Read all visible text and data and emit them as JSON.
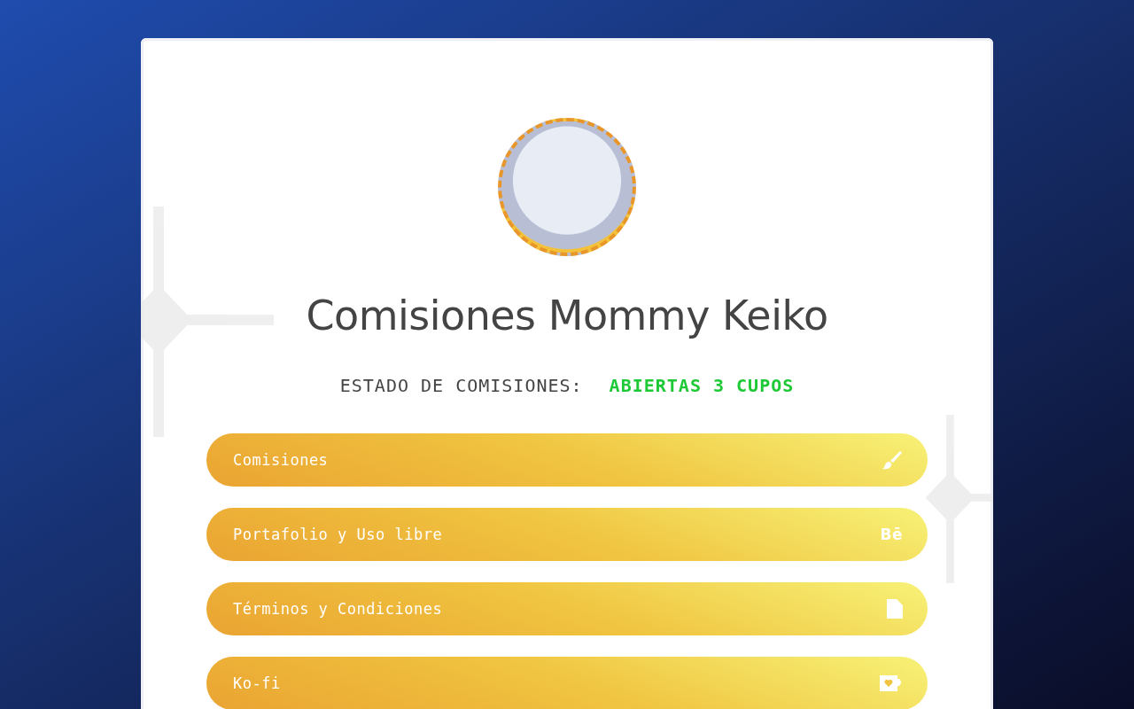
{
  "title": "Comisiones Mommy Keiko",
  "status": {
    "label": "ESTADO DE COMISIONES:",
    "value": "ABIERTAS 3 CUPOS",
    "color": "#1ec936"
  },
  "links": [
    {
      "label": "Comisiones",
      "kind": "brush"
    },
    {
      "label": "Portafolio y Uso libre",
      "kind": "logo",
      "glyph": "Bē"
    },
    {
      "label": "Términos y Condiciones",
      "kind": "file"
    },
    {
      "label": "Ko-fi",
      "kind": "cup"
    }
  ]
}
